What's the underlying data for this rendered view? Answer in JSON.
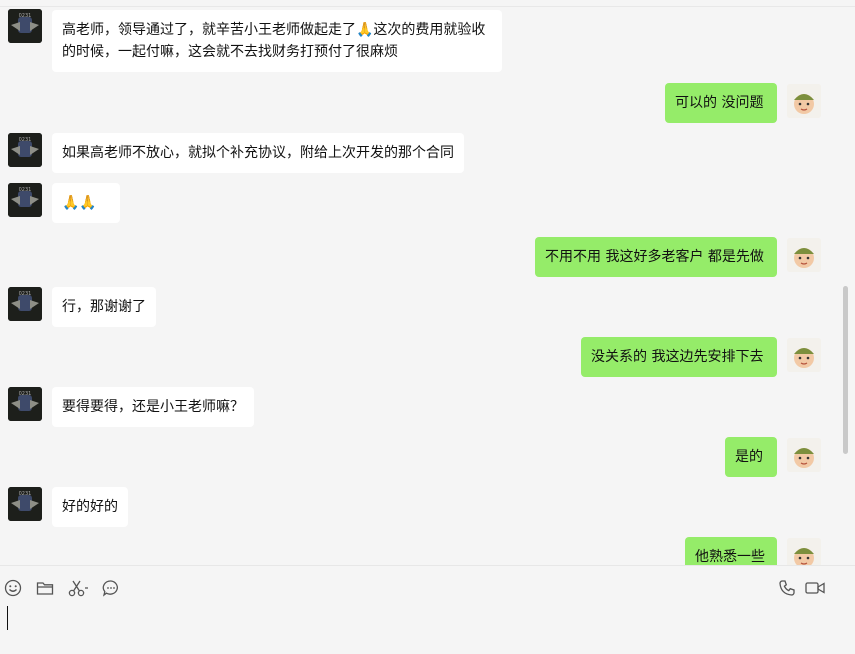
{
  "messages": [
    {
      "side": "in",
      "text": "高老师，领导通过了，就辛苦小王老师做起走了🙏这次的费用就验收的时候，一起付嘛，这会就不去找财务打预付了很麻烦"
    },
    {
      "side": "out",
      "text": "可以的 没问题"
    },
    {
      "side": "in",
      "text": "如果高老师不放心，就拟个补充协议，附给上次开发的那个合同"
    },
    {
      "side": "in",
      "text": "🙏🙏"
    },
    {
      "side": "out",
      "text": "不用不用 我这好多老客户 都是先做"
    },
    {
      "side": "in",
      "text": "行，那谢谢了"
    },
    {
      "side": "out",
      "text": "没关系的 我这边先安排下去"
    },
    {
      "side": "in",
      "text": "要得要得，还是小王老师嘛？"
    },
    {
      "side": "out",
      "text": "是的"
    },
    {
      "side": "in",
      "text": "好的好的"
    },
    {
      "side": "out",
      "text": "他熟悉一些"
    }
  ],
  "toolbar": {
    "icons": [
      "emoji-icon",
      "folder-icon",
      "scissors-icon",
      "chat-history-icon",
      "phone-icon",
      "video-call-icon"
    ]
  },
  "colors": {
    "background": "#f5f5f5",
    "incoming_bubble": "#ffffff",
    "outgoing_bubble": "#95ec69"
  },
  "input": {
    "value": ""
  }
}
